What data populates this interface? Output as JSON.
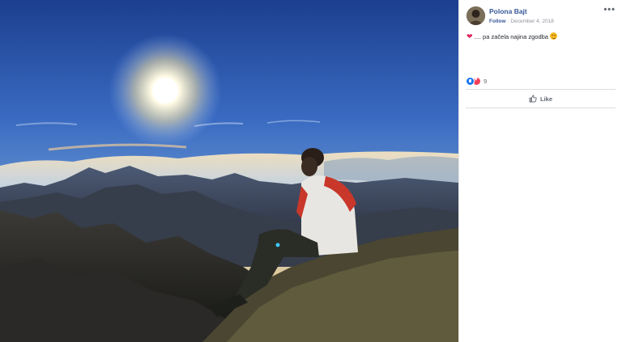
{
  "post": {
    "author_name": "Polona Bajt",
    "follow_label": "Follow",
    "separator": "·",
    "date": "December 4, 2018",
    "more_label": "•••",
    "caption_text": ".... pa začela najina zgodba",
    "reaction_count": "9",
    "like_label": "Like"
  },
  "icons": {
    "more": "more-options-icon",
    "heart": "red-heart-emoji-icon",
    "face": "smiling-face-with-heart-eyes-emoji-icon",
    "like_reaction": "like-reaction-icon",
    "love_reaction": "love-reaction-icon",
    "like_button": "thumbs-up-icon"
  },
  "colors": {
    "link_blue": "#365899",
    "meta_gray": "#90949c",
    "like_blue": "#1877f2",
    "love_red": "#f33e58"
  }
}
